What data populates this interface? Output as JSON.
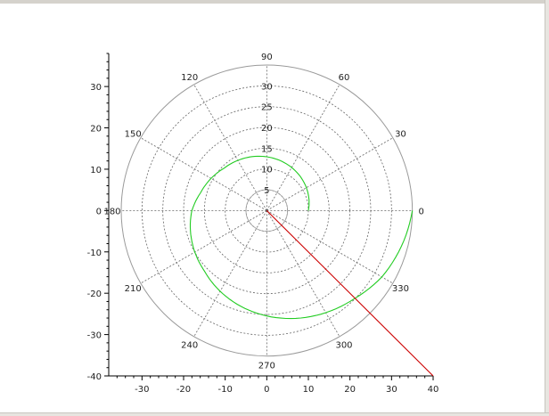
{
  "colors": {
    "spiral": "#22cc22",
    "line": "#cc0000",
    "axis": "#000000",
    "grid": "#666666",
    "frame": "#9a9a9a"
  },
  "chart_data": {
    "type": "line",
    "coordinate_system": "polar-overlay",
    "title": "",
    "xlabel": "",
    "ylabel": "",
    "xlim": [
      -38,
      40
    ],
    "ylim": [
      -40,
      38
    ],
    "x_ticks": [
      -30,
      -20,
      -10,
      0,
      10,
      20,
      30,
      40
    ],
    "y_ticks": [
      -40,
      -30,
      -20,
      -10,
      0,
      10,
      20,
      30
    ],
    "grid": true,
    "polar_grid": {
      "rmax": 35,
      "radial_ticks": [
        5,
        10,
        15,
        20,
        25,
        30
      ],
      "angle_ticks": [
        0,
        30,
        60,
        90,
        120,
        150,
        180,
        210,
        240,
        270,
        300,
        330
      ]
    },
    "series": [
      {
        "color": "spiral",
        "polar": true,
        "points": [
          [
            0,
            10
          ],
          [
            15,
            10.5
          ],
          [
            30,
            11
          ],
          [
            45,
            11.5
          ],
          [
            60,
            12
          ],
          [
            75,
            12.5
          ],
          [
            90,
            13
          ],
          [
            105,
            13.5
          ],
          [
            120,
            14
          ],
          [
            135,
            14.5
          ],
          [
            150,
            15.5
          ],
          [
            165,
            16.5
          ],
          [
            180,
            18
          ],
          [
            195,
            19
          ],
          [
            210,
            20
          ],
          [
            225,
            21
          ],
          [
            240,
            22.5
          ],
          [
            255,
            24
          ],
          [
            270,
            25.5
          ],
          [
            285,
            27
          ],
          [
            300,
            28.5
          ],
          [
            315,
            30
          ],
          [
            330,
            32
          ],
          [
            345,
            33.5
          ],
          [
            360,
            35
          ]
        ]
      },
      {
        "color": "line",
        "polar": false,
        "points": [
          [
            0,
            0
          ],
          [
            40,
            -40
          ]
        ]
      }
    ]
  }
}
